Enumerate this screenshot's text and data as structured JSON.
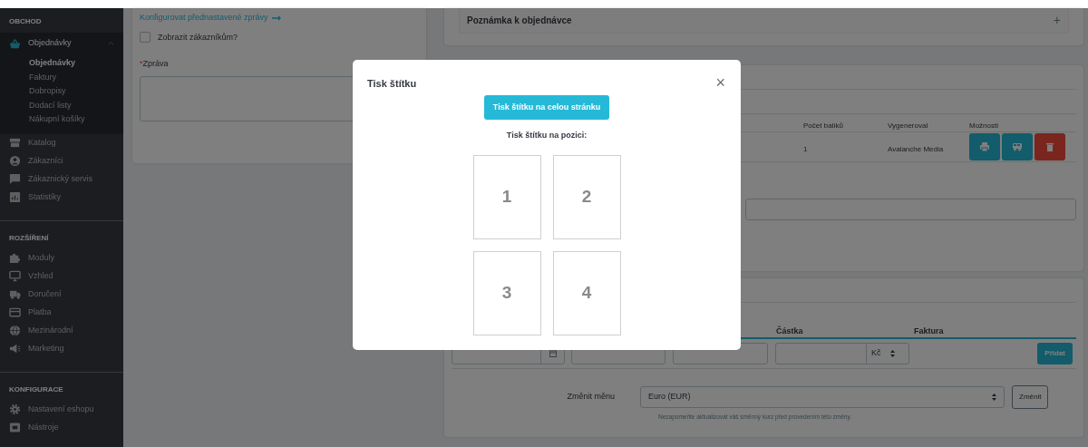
{
  "sidebar": {
    "sections": [
      {
        "title": "OBCHOD",
        "items": [
          {
            "label": "Objednávky",
            "active": true,
            "expanded": true,
            "children": [
              {
                "label": "Objednávky",
                "selected": true
              },
              {
                "label": "Faktury",
                "selected": false
              },
              {
                "label": "Dobropisy",
                "selected": false
              },
              {
                "label": "Dodací listy",
                "selected": false
              },
              {
                "label": "Nákupní košíky",
                "selected": false
              }
            ]
          },
          {
            "label": "Katalog",
            "active": false
          },
          {
            "label": "Zákazníci",
            "active": false
          },
          {
            "label": "Zákaznický servis",
            "active": false
          },
          {
            "label": "Statistiky",
            "active": false
          }
        ]
      },
      {
        "title": "ROZŠÍŘENÍ",
        "items": [
          {
            "label": "Moduly",
            "active": false
          },
          {
            "label": "Vzhled",
            "active": false
          },
          {
            "label": "Doručení",
            "active": false
          },
          {
            "label": "Platba",
            "active": false
          },
          {
            "label": "Mezinárodní",
            "active": false
          },
          {
            "label": "Marketing",
            "active": false
          }
        ]
      },
      {
        "title": "KONFIGURACE",
        "items": [
          {
            "label": "Nastavení eshopu",
            "active": false
          },
          {
            "label": "Nástroje",
            "active": false
          }
        ]
      }
    ]
  },
  "message_card": {
    "link": "Konfigurovat přednastavené zprávy",
    "checkbox": {
      "label": "Zobrazit zákazníkům?",
      "checked": false
    },
    "field": {
      "required_mark": "*",
      "label": "Zpráva"
    }
  },
  "note_panel": {
    "title": "Poznámka k objednávce",
    "toggle": "+"
  },
  "shipping": {
    "columns": [
      "Počet balíků",
      "Vygeneroval",
      "Možnosti"
    ],
    "rows": [
      {
        "cells": [
          "1",
          "Avalanche Media"
        ],
        "actions": [
          {
            "kind": "print"
          },
          {
            "kind": "ship"
          },
          {
            "kind": "delete"
          }
        ]
      }
    ]
  },
  "payments": {
    "columns": [
      "Částka",
      "Faktura"
    ],
    "currency": "Kč",
    "add_button": "Přidat"
  },
  "currency_change": {
    "label": "Změnit měnu",
    "value": "Euro (EUR)",
    "button": "Změnit",
    "help": "Nezapomeňte aktualizovat váš směnný kurz před provedením této změny."
  },
  "modal": {
    "title": "Tisk štítku",
    "close": "×",
    "full_page_button": "Tisk štítku na celou stránku",
    "subtitle": "Tisk štítku na pozici:",
    "positions": [
      "1",
      "2",
      "3",
      "4"
    ]
  }
}
